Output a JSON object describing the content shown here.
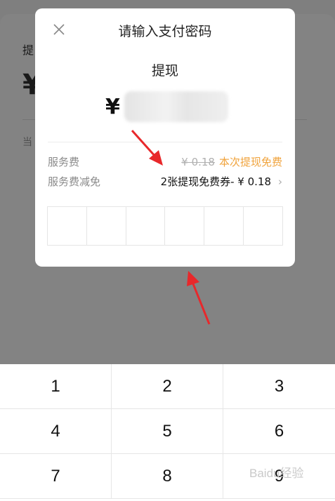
{
  "background": {
    "label": "提",
    "currency": "¥",
    "note": "当"
  },
  "modal": {
    "title": "请输入支付密码",
    "withdraw_label": "提现",
    "currency_symbol": "¥",
    "service_fee_label": "服务费",
    "service_fee_original": "¥ 0.18",
    "service_fee_free": "本次提现免费",
    "fee_reduction_label": "服务费减免",
    "fee_reduction_value": "2张提现免费券- ¥ 0.18",
    "pin_length": 6
  },
  "icons": {
    "close": "close-icon",
    "chevron": "chevron-right-icon"
  },
  "keypad": {
    "keys": [
      "1",
      "2",
      "3",
      "4",
      "5",
      "6",
      "7",
      "8",
      "9"
    ]
  },
  "watermark": "Baidu经验",
  "colors": {
    "accent_orange": "#f0a33c",
    "annotation_red": "#e8282b",
    "overlay": "#7f7f7f"
  }
}
